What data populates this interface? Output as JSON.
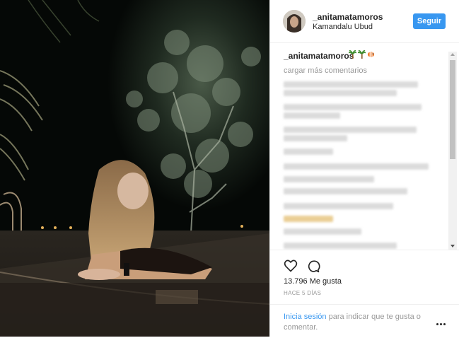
{
  "post": {
    "username": "_anitamatamoros",
    "location": "Kamandalu Ubud",
    "follow_label": "Seguir"
  },
  "comments": {
    "caption_username": "_anitamatamoros",
    "caption_emojis": [
      "palm-tree",
      "palm-tree",
      "tropical-fish"
    ],
    "load_more": "cargar más comentarios"
  },
  "actions": {
    "like_icon": "heart-icon",
    "comment_icon": "comment-icon",
    "likes_count": "13.796",
    "likes_label": "Me gusta",
    "timestamp": "HACE 5 DÍAS"
  },
  "login": {
    "link": "Inicia sesión",
    "text": "para indicar que te gusta o comentar."
  },
  "colors": {
    "accent": "#3897f0",
    "text": "#262626",
    "muted": "#999999",
    "border": "#efefef"
  }
}
